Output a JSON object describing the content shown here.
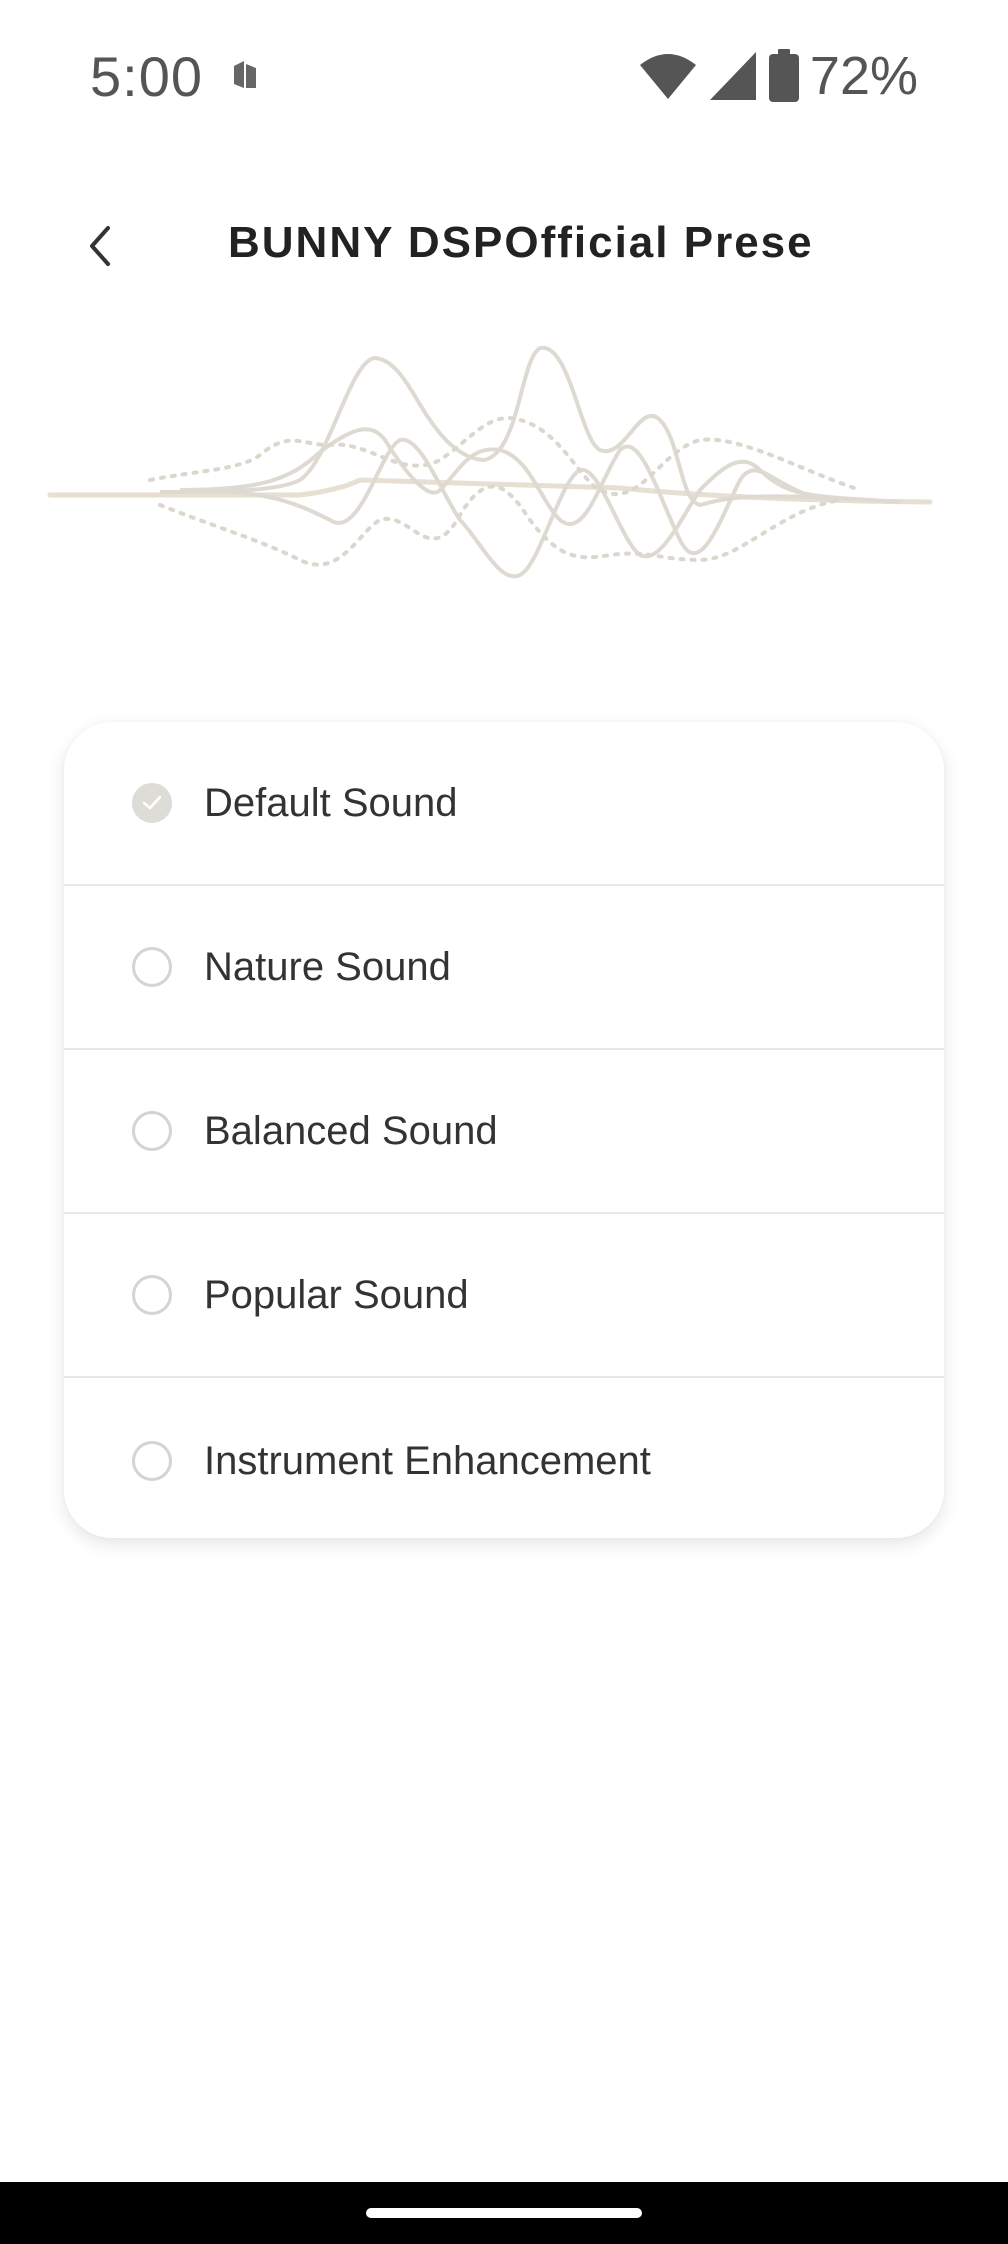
{
  "status_bar": {
    "time": "5:00",
    "battery": "72%"
  },
  "header": {
    "title": "BUNNY DSPOfficial Prese"
  },
  "presets": [
    {
      "label": "Default Sound",
      "selected": true
    },
    {
      "label": "Nature Sound",
      "selected": false
    },
    {
      "label": "Balanced Sound",
      "selected": false
    },
    {
      "label": "Popular Sound",
      "selected": false
    },
    {
      "label": "Instrument Enhancement",
      "selected": false
    }
  ],
  "icons": {
    "back": "chevron-left-icon",
    "wifi": "wifi-icon",
    "signal": "cell-signal-icon",
    "battery": "battery-icon",
    "notification": "app-notification-icon",
    "check": "check-icon"
  },
  "colors": {
    "wave": "#d9d4c8",
    "radio_selected": "#dddcd6",
    "divider": "#e7e7e7"
  }
}
